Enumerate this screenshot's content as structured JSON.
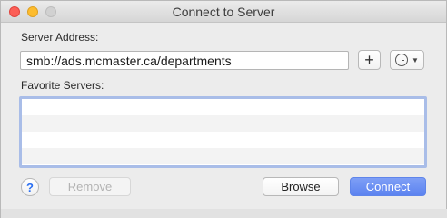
{
  "window": {
    "title": "Connect to Server"
  },
  "server_address": {
    "label": "Server Address:",
    "value": "smb://ads.mcmaster.ca/departments"
  },
  "buttons": {
    "add_label": "+",
    "help_label": "?",
    "remove_label": "Remove",
    "browse_label": "Browse",
    "connect_label": "Connect"
  },
  "favorites": {
    "label": "Favorite Servers:",
    "items": []
  },
  "icons": {
    "add": "plus-icon",
    "recent": "clock-icon",
    "recent_menu": "chevron-down-icon"
  },
  "colors": {
    "accent": "#5c83f0",
    "list_focus_ring": "#a9bde8"
  }
}
